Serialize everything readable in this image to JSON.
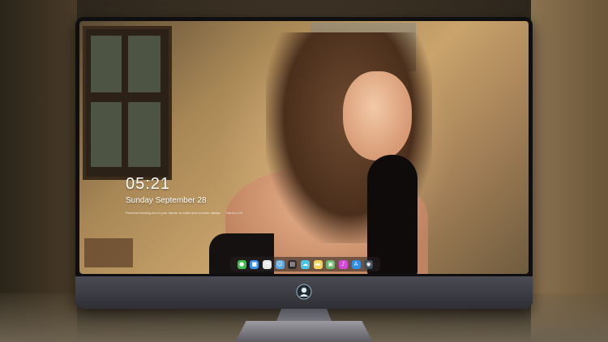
{
  "lock_screen": {
    "time": "05:21",
    "date": "Sunday September  28",
    "tagline": "Personal tracking tool in your hands, to make your monitor always",
    "tagline_tail": "Hot to u Ch"
  },
  "dock": {
    "icons": [
      {
        "name": "messages-icon",
        "glyph": "●",
        "color": "#3bbf4a"
      },
      {
        "name": "files-icon",
        "glyph": "■",
        "color": "#3a8ee6"
      },
      {
        "name": "clock-icon",
        "glyph": "◔",
        "color": "#e8e8e8"
      },
      {
        "name": "finder-icon",
        "glyph": "☺",
        "color": "#5aa7e0"
      },
      {
        "name": "clapper-icon",
        "glyph": "▤",
        "color": "#2b2b2b"
      },
      {
        "name": "weather-icon",
        "glyph": "☁",
        "color": "#4cc4e8"
      },
      {
        "name": "notes-icon",
        "glyph": "▬",
        "color": "#f3d35a"
      },
      {
        "name": "photos-icon",
        "glyph": "▣",
        "color": "#6ab56a"
      },
      {
        "name": "music-icon",
        "glyph": "♪",
        "color": "#d24ad6"
      },
      {
        "name": "appstore-icon",
        "glyph": "A",
        "color": "#2f8fe8"
      },
      {
        "name": "camera-icon",
        "glyph": "◉",
        "color": "#3e4c5a"
      }
    ]
  },
  "colors": {
    "monitor_bezel": "#0f0f11",
    "monitor_chin": "#3b3b43",
    "text": "#ffffff"
  }
}
